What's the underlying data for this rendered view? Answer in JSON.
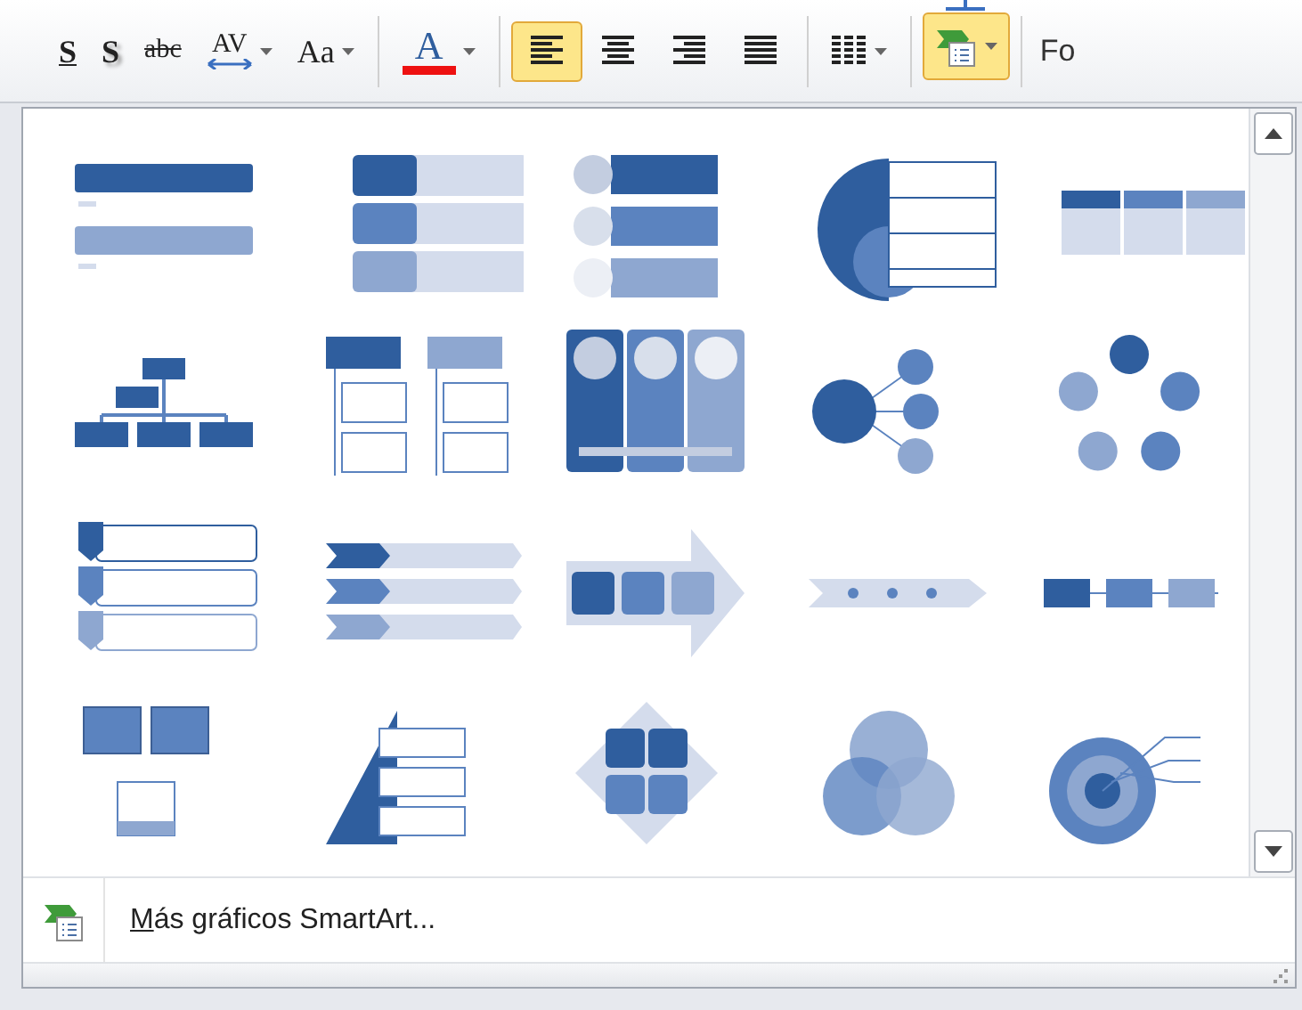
{
  "toolbar": [
    {
      "kind": "underline",
      "glyph": "S",
      "selected": false
    },
    {
      "kind": "shadow",
      "glyph": "S",
      "selected": false
    },
    {
      "kind": "strike",
      "glyph": "abc",
      "selected": false
    },
    {
      "kind": "spacing",
      "glyph": "AV",
      "selected": false,
      "dropdown": true
    },
    {
      "kind": "case",
      "glyph": "Aa",
      "selected": false,
      "dropdown": true
    },
    {
      "kind": "separator"
    },
    {
      "kind": "fontcolor",
      "glyph": "A",
      "selected": false,
      "dropdown": true
    },
    {
      "kind": "separator"
    },
    {
      "kind": "align-left",
      "selected": true
    },
    {
      "kind": "align-center",
      "selected": false
    },
    {
      "kind": "align-right",
      "selected": false
    },
    {
      "kind": "justify",
      "selected": false
    },
    {
      "kind": "separator"
    },
    {
      "kind": "columns",
      "selected": false,
      "dropdown": true
    },
    {
      "kind": "separator"
    },
    {
      "kind": "smartart",
      "selected": true,
      "dropdown": true
    },
    {
      "kind": "separator"
    },
    {
      "kind": "text",
      "glyph": "Fo"
    }
  ],
  "gallery": [
    {
      "kind": "bars"
    },
    {
      "kind": "blocks"
    },
    {
      "kind": "circle-bars"
    },
    {
      "kind": "arc-table"
    },
    {
      "kind": "table"
    },
    {
      "kind": "org"
    },
    {
      "kind": "tree"
    },
    {
      "kind": "columns"
    },
    {
      "kind": "hub"
    },
    {
      "kind": "cycle"
    },
    {
      "kind": "chevrons"
    },
    {
      "kind": "arrows"
    },
    {
      "kind": "big-arrow"
    },
    {
      "kind": "timeline"
    },
    {
      "kind": "steps"
    },
    {
      "kind": "picture-blocks"
    },
    {
      "kind": "pyramid"
    },
    {
      "kind": "matrix"
    },
    {
      "kind": "venn"
    },
    {
      "kind": "target"
    }
  ],
  "footer": {
    "label_underlined": "M",
    "label_rest": "ás gráficos SmartArt..."
  }
}
